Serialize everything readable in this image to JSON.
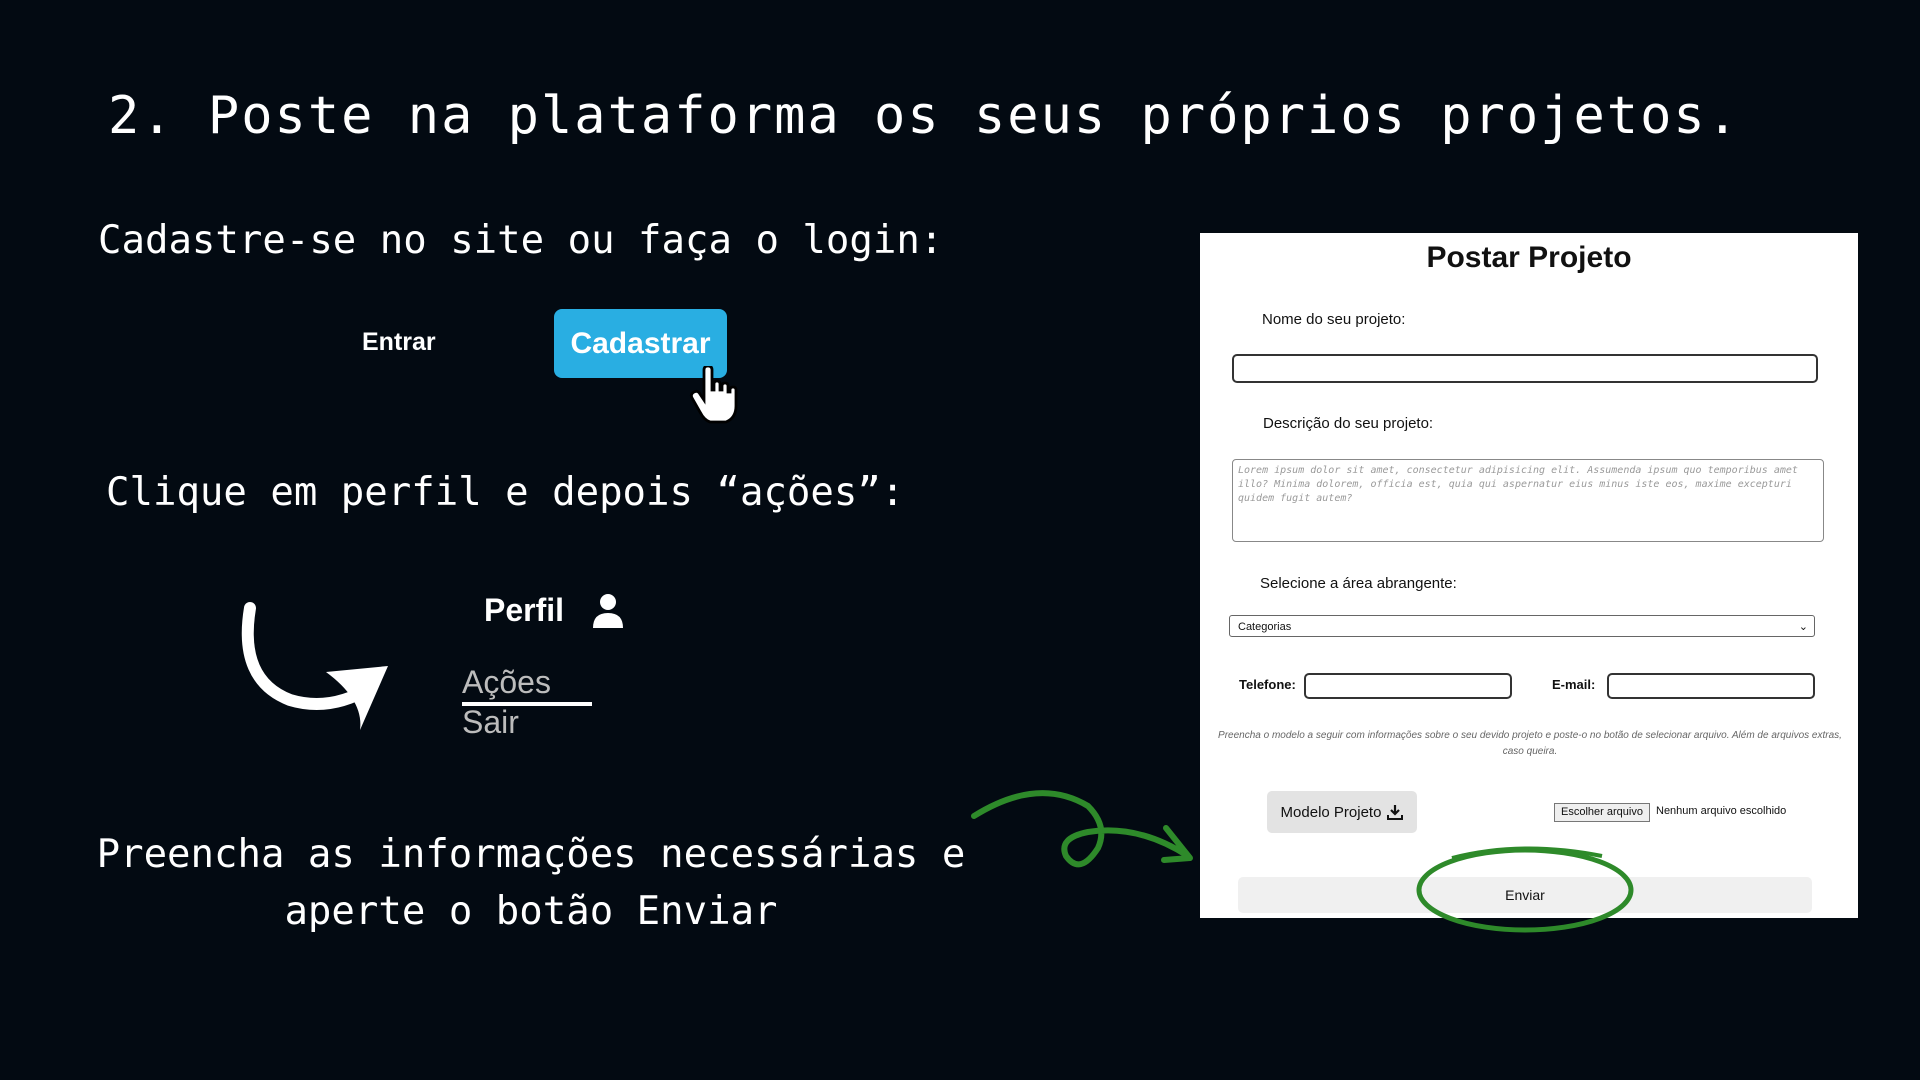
{
  "slide": {
    "title": "2. Poste na plataforma os seus próprios projetos.",
    "step1": "Cadastre-se no site ou faça o login:",
    "step2": "Clique em perfil e depois “ações”:",
    "step3": "Preencha as informações necessárias e aperte o botão Enviar"
  },
  "login": {
    "entrar_label": "Entrar",
    "cadastrar_label": "Cadastrar",
    "cadastrar_color": "#29aee2"
  },
  "profile_menu": {
    "perfil_label": "Perfil",
    "acoes_label": "Ações",
    "sair_label": "Sair"
  },
  "form": {
    "title": "Postar Projeto",
    "name_label": "Nome do seu projeto:",
    "name_value": "",
    "description_label": "Descrição do seu projeto:",
    "description_placeholder": "Lorem ipsum dolor sit amet, consectetur adipisicing elit. Assumenda ipsum quo temporibus amet illo? Minima dolorem, officia est, quia qui aspernatur eius minus iste eos, maxime excepturi quidem fugit autem?",
    "area_label": "Selecione a área abrangente:",
    "area_selected": "Categorias",
    "phone_label": "Telefone:",
    "email_label": "E-mail:",
    "note": "Preencha o modelo a seguir com informações sobre o seu devido projeto e poste-o no botão de selecionar arquivo. Além de arquivos extras, caso queira.",
    "modelo_button": "Modelo Projeto",
    "file_button": "Escolher arquivo",
    "file_status": "Nenhum arquivo escolhido",
    "submit_label": "Enviar"
  },
  "colors": {
    "background": "#030a12",
    "highlight_green": "#2e8a2a"
  },
  "icons": {
    "cursor": "hand-pointer-icon",
    "profile": "user-icon",
    "download": "download-icon"
  }
}
